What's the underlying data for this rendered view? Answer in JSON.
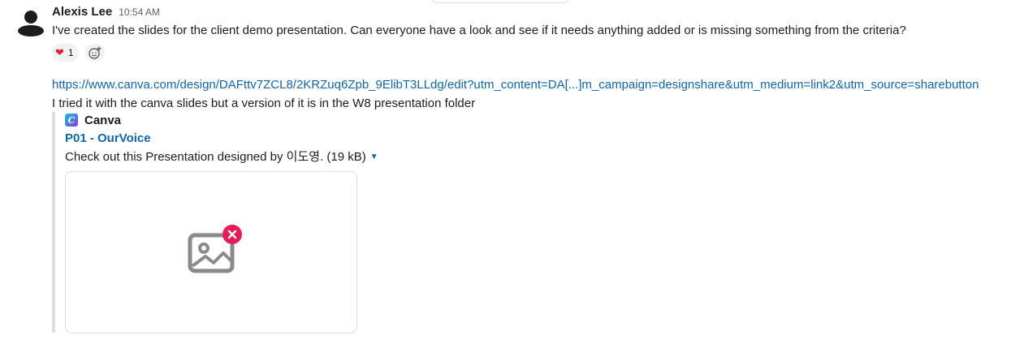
{
  "message": {
    "sender": "Alexis Lee",
    "time": "10:54 AM",
    "text": "I've created the slides for the client demo presentation. Can everyone have a look and see if it needs anything added or is missing something from the criteria?",
    "reactions": [
      {
        "emoji": "heart",
        "count": "1"
      }
    ],
    "add_reaction_icon": "add-emoji-icon",
    "link": "https://www.canva.com/design/DAFttv7ZCL8/2KRZuq6Zpb_9ElibT3LLdg/edit?utm_content=DA[...]m_campaign=designshare&utm_medium=link2&utm_source=sharebutton",
    "followup_text": "I tried it with the canva slides but a version of it is in the W8 presentation folder"
  },
  "unfurl": {
    "service_name": "Canva",
    "service_logo_letter": "C",
    "title": "P01 - OurVoice",
    "description": "Check out this Presentation designed by 이도영. (19 kB)",
    "preview_icon": "broken-image-icon"
  },
  "colors": {
    "link": "#1264a3",
    "heart": "#e01e3c",
    "error_badge": "#e01e5a"
  }
}
